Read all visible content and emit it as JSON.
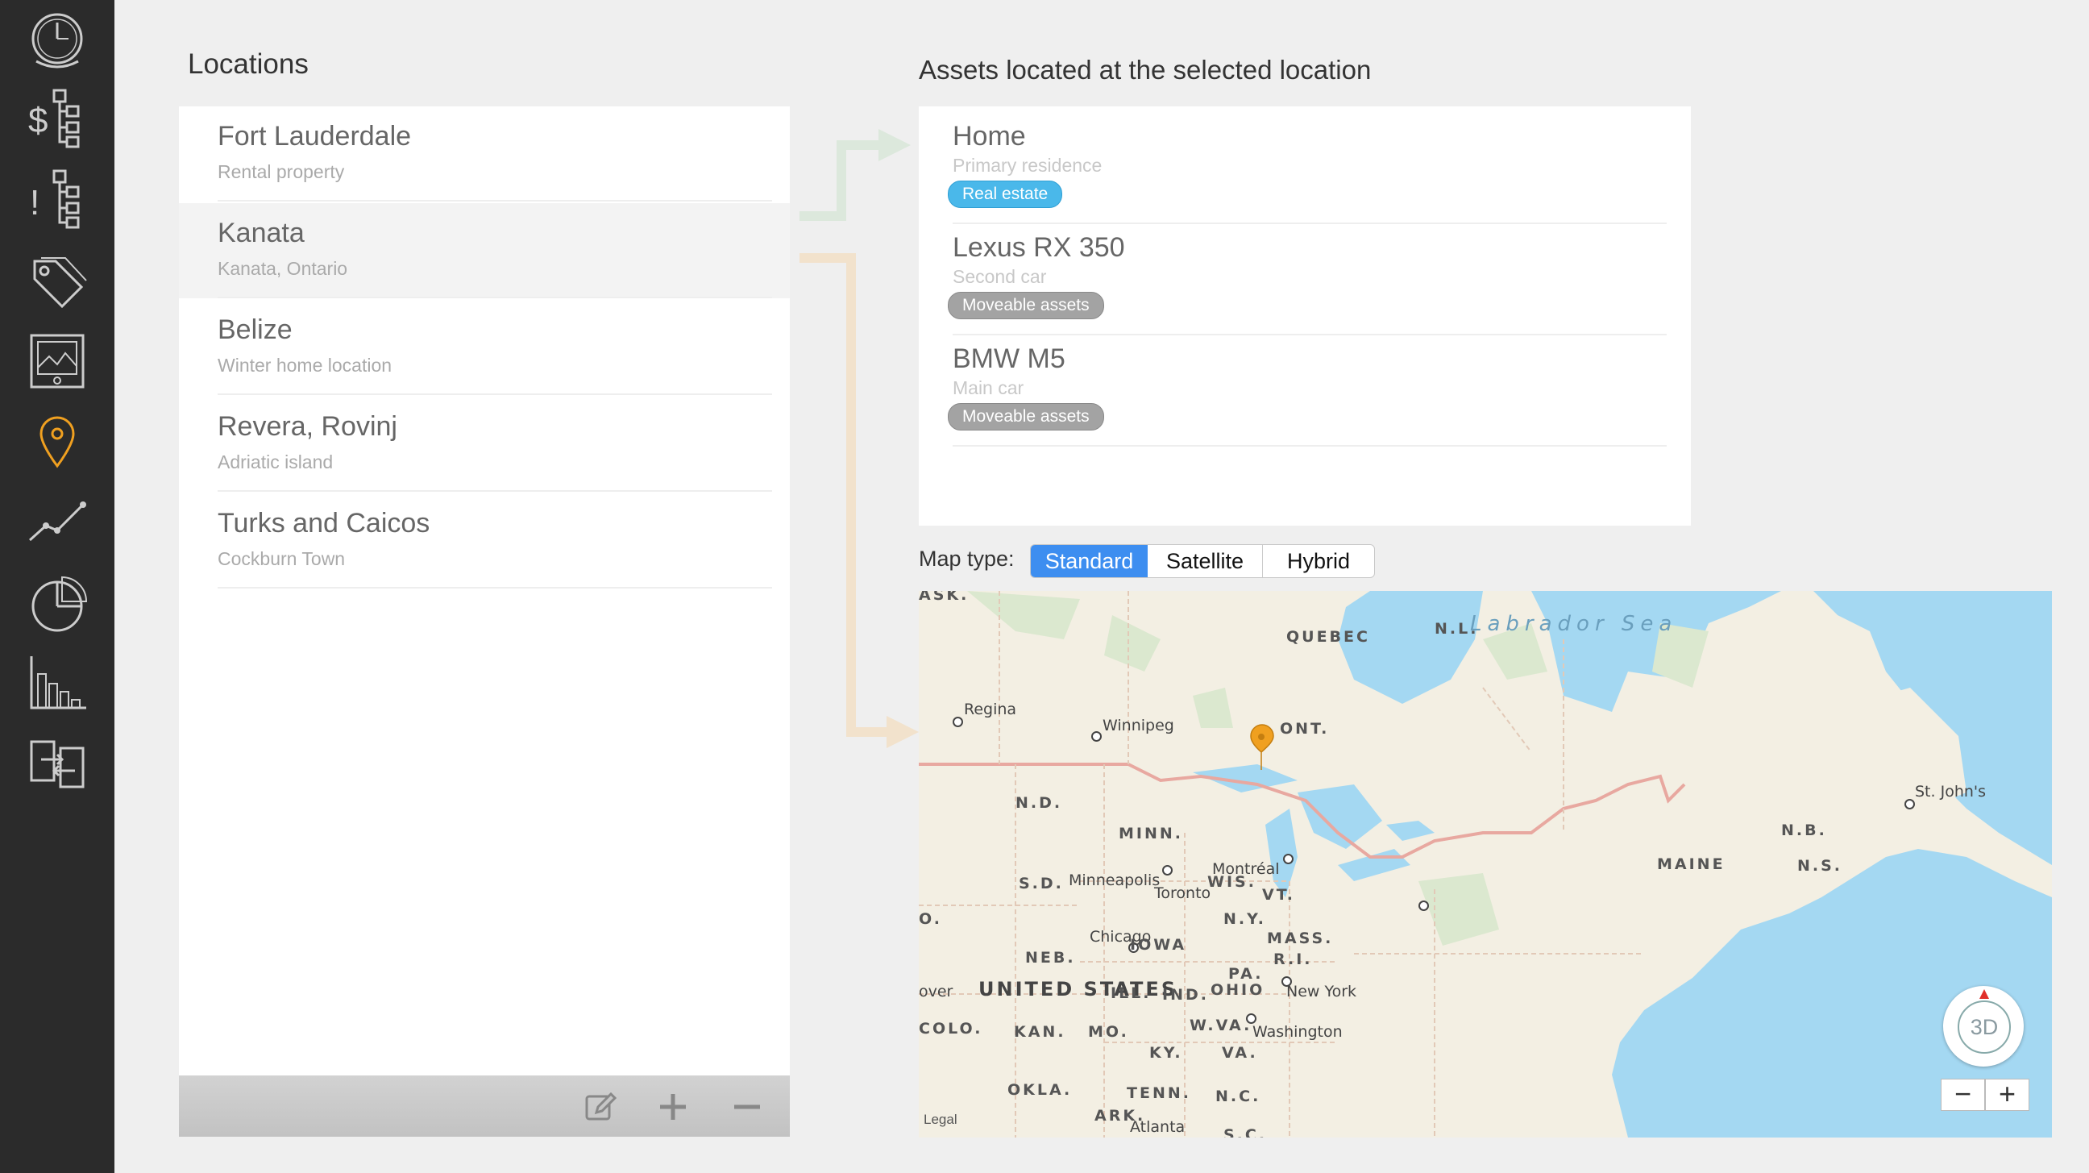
{
  "sidebar": {
    "items": [
      {
        "icon": "dashboard-icon"
      },
      {
        "icon": "budget-tree-icon"
      },
      {
        "icon": "alerts-tree-icon"
      },
      {
        "icon": "tags-icon"
      },
      {
        "icon": "picture-frame-icon"
      },
      {
        "icon": "location-pin-icon",
        "active": true
      },
      {
        "icon": "line-chart-icon"
      },
      {
        "icon": "pie-chart-icon"
      },
      {
        "icon": "bar-chart-icon"
      },
      {
        "icon": "import-export-icon"
      }
    ],
    "colors": {
      "background": "#2b2b2b",
      "icon": "#cccccc",
      "active": "#f0a020"
    }
  },
  "locations": {
    "title": "Locations",
    "items": [
      {
        "name": "Fort Lauderdale",
        "subtitle": "Rental property"
      },
      {
        "name": "Kanata",
        "subtitle": "Kanata, Ontario",
        "selected": true
      },
      {
        "name": "Belize",
        "subtitle": "Winter home location"
      },
      {
        "name": "Revera, Rovinj",
        "subtitle": "Adriatic island"
      },
      {
        "name": "Turks and Caicos",
        "subtitle": "Cockburn Town"
      }
    ],
    "toolbar": {
      "icons": [
        "edit-icon",
        "plus-icon",
        "minus-icon"
      ]
    }
  },
  "assets": {
    "title": "Assets located at the selected location",
    "items": [
      {
        "name": "Home",
        "subtitle": "Primary residence",
        "tag": "Real estate",
        "tag_color": "#4ab8ea"
      },
      {
        "name": "Lexus RX 350",
        "subtitle": "Second car",
        "tag": "Moveable assets",
        "tag_color": "#a3a3a3"
      },
      {
        "name": "BMW M5",
        "subtitle": "Main car",
        "tag": "Moveable assets",
        "tag_color": "#a3a3a3"
      }
    ]
  },
  "map_type": {
    "label": "Map type:",
    "options": [
      "Standard",
      "Satellite",
      "Hybrid"
    ],
    "selected": "Standard",
    "accent": "#3d8ef0"
  },
  "map": {
    "labels": {
      "ask": "ASK.",
      "quebec": "QUEBEC",
      "nl": "N.L.",
      "labrador": "Labrador Sea",
      "regina": "Regina",
      "winnipeg": "Winnipeg",
      "ont": "ONT.",
      "nd": "N.D.",
      "minn": "MINN.",
      "stjohns": "St. John's",
      "nb": "N.B.",
      "maine": "MAINE",
      "ns": "N.S.",
      "sd": "S.D.",
      "minneapolis": "Minneapolis",
      "wis": "WIS.",
      "montreal": "Montréal",
      "toronto": "Toronto",
      "vt": "VT.",
      "ny": "N.Y.",
      "o": "O.",
      "chicago": "Chicago",
      "neb": "NEB.",
      "iowa": "IOWA",
      "mass": "MASS.",
      "ri": "R.I.",
      "pa": "PA.",
      "over": "over",
      "us": "UNITED STATES",
      "ill": "ILL.",
      "ind": "IND.",
      "ohio": "OHIO",
      "newyork": "New York",
      "colo": "COLO.",
      "kan": "KAN.",
      "mo": "MO.",
      "wva": "W.VA.",
      "washington": "Washington",
      "ky": "KY.",
      "va": "VA.",
      "okla": "OKLA.",
      "ark": "ARK.",
      "tenn": "TENN.",
      "nc": "N.C.",
      "atlanta": "Atlanta",
      "sc": "S.C."
    },
    "compass_label": "3D",
    "zoom_out": "−",
    "zoom_in": "+",
    "legal": "Legal",
    "pin_color": "#f0a020"
  }
}
